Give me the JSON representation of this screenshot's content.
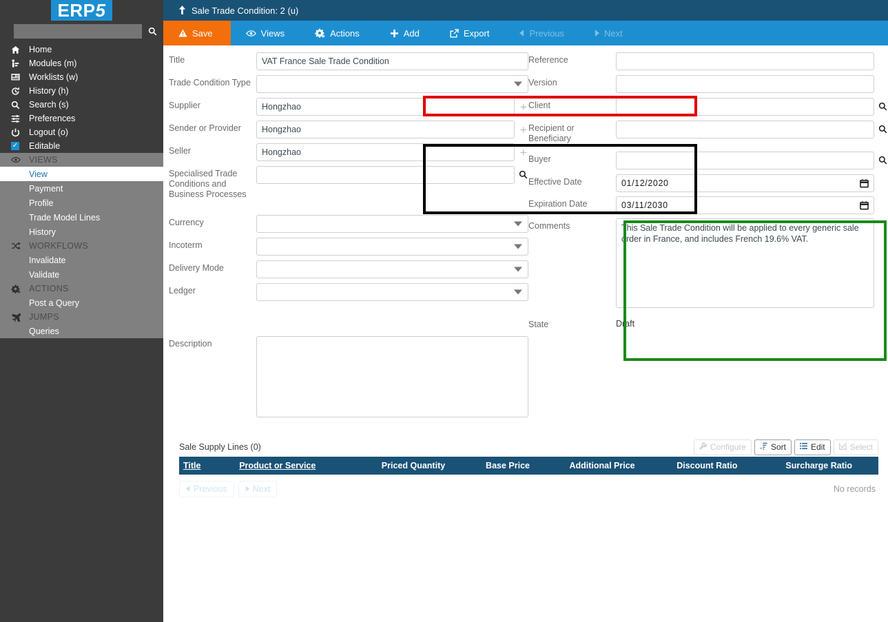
{
  "brand": {
    "logo_text": "ERP",
    "logo_suffix": "5"
  },
  "sidebar": {
    "search": {
      "value": "",
      "placeholder": "",
      "icon": "search-icon"
    },
    "nav": [
      {
        "label": "Home",
        "icon": "home-icon"
      },
      {
        "label": "Modules (m)",
        "icon": "modules-icon"
      },
      {
        "label": "Worklists (w)",
        "icon": "worklists-icon"
      },
      {
        "label": "History (h)",
        "icon": "history-icon"
      },
      {
        "label": "Search (s)",
        "icon": "search-icon"
      },
      {
        "label": "Preferences",
        "icon": "preferences-icon"
      },
      {
        "label": "Logout (o)",
        "icon": "power-icon"
      },
      {
        "label": "Editable",
        "icon": "checkbox-checked-icon"
      }
    ],
    "groups": [
      {
        "title": "VIEWS",
        "icon": "eye-icon",
        "items": [
          {
            "label": "View",
            "active": true
          },
          {
            "label": "Payment",
            "active": false
          },
          {
            "label": "Profile",
            "active": false
          },
          {
            "label": "Trade Model Lines",
            "active": false
          },
          {
            "label": "History",
            "active": false
          }
        ]
      },
      {
        "title": "WORKFLOWS",
        "icon": "shuffle-icon",
        "items": [
          {
            "label": "Invalidate",
            "active": false
          },
          {
            "label": "Validate",
            "active": false
          }
        ]
      },
      {
        "title": "ACTIONS",
        "icon": "gear-icon",
        "items": [
          {
            "label": "Post a Query",
            "active": false
          }
        ]
      },
      {
        "title": "JUMPS",
        "icon": "plane-icon",
        "items": [
          {
            "label": "Queries",
            "active": false
          }
        ]
      }
    ]
  },
  "header": {
    "breadcrumb_icon": "up-arrow-icon",
    "breadcrumb": "Sale Trade Condition: 2 (u)"
  },
  "toolbar": [
    {
      "label": "Save",
      "icon": "warning-triangle-icon",
      "state": "primary"
    },
    {
      "label": "Views",
      "icon": "eye-icon",
      "state": "normal"
    },
    {
      "label": "Actions",
      "icon": "gear-icon",
      "state": "normal"
    },
    {
      "label": "Add",
      "icon": "plus-icon",
      "state": "normal"
    },
    {
      "label": "Export",
      "icon": "export-icon",
      "state": "normal"
    },
    {
      "label": "Previous",
      "icon": "triangle-left-icon",
      "state": "disabled"
    },
    {
      "label": "Next",
      "icon": "triangle-right-icon",
      "state": "disabled"
    }
  ],
  "form": {
    "left": {
      "title": {
        "label": "Title",
        "value": "VAT France Sale Trade Condition"
      },
      "trade_cond_type": {
        "label": "Trade Condition Type",
        "value": ""
      },
      "supplier": {
        "label": "Supplier",
        "value": "Hongzhao"
      },
      "sender": {
        "label": "Sender or Provider",
        "value": "Hongzhao"
      },
      "seller": {
        "label": "Seller",
        "value": "Hongzhao"
      },
      "specialised": {
        "label": "Specialised Trade Conditions and Business Processes",
        "value": ""
      },
      "currency": {
        "label": "Currency",
        "value": ""
      },
      "incoterm": {
        "label": "Incoterm",
        "value": ""
      },
      "delivery_mode": {
        "label": "Delivery Mode",
        "value": ""
      },
      "ledger": {
        "label": "Ledger",
        "value": ""
      },
      "description": {
        "label": "Description",
        "value": ""
      }
    },
    "right": {
      "reference": {
        "label": "Reference",
        "value": ""
      },
      "version": {
        "label": "Version",
        "value": ""
      },
      "client": {
        "label": "Client",
        "value": ""
      },
      "recipient": {
        "label": "Recipient or Beneficiary",
        "value": ""
      },
      "buyer": {
        "label": "Buyer",
        "value": ""
      },
      "effective_date": {
        "label": "Effective Date",
        "value": "01/12/2020"
      },
      "expiration_date": {
        "label": "Expiration Date",
        "value": "03/11/2030"
      },
      "comments": {
        "label": "Comments",
        "value": "This Sale Trade Condition will be applied to every generic sale order in France, and includes French 19.6% VAT."
      },
      "state": {
        "label": "State",
        "value": "Draft"
      }
    }
  },
  "highlights": [
    {
      "name": "title-highlight",
      "color": "#e00000"
    },
    {
      "name": "party-highlight",
      "color": "#000000"
    },
    {
      "name": "dates-highlight",
      "color": "#1a8a1a"
    }
  ],
  "listbox": {
    "title": "Sale Supply Lines (0)",
    "tools": [
      {
        "label": "Configure",
        "icon": "wrench-icon",
        "enabled": false
      },
      {
        "label": "Sort",
        "icon": "sort-icon",
        "enabled": true
      },
      {
        "label": "Edit",
        "icon": "list-icon",
        "enabled": true
      },
      {
        "label": "Select",
        "icon": "checkbox-icon",
        "enabled": false
      }
    ],
    "columns": [
      {
        "label": "Title",
        "sortable": true,
        "align": "left"
      },
      {
        "label": "Product or Service",
        "sortable": true,
        "align": "left"
      },
      {
        "label": "Priced Quantity",
        "sortable": false,
        "align": "center"
      },
      {
        "label": "Base Price",
        "sortable": false,
        "align": "center"
      },
      {
        "label": "Additional Price",
        "sortable": false,
        "align": "center"
      },
      {
        "label": "Discount Ratio",
        "sortable": false,
        "align": "center"
      },
      {
        "label": "Surcharge Ratio",
        "sortable": false,
        "align": "center"
      }
    ],
    "rows": [],
    "pagination": {
      "previous": "Previous",
      "next": "Next"
    },
    "empty_text": "No records"
  }
}
